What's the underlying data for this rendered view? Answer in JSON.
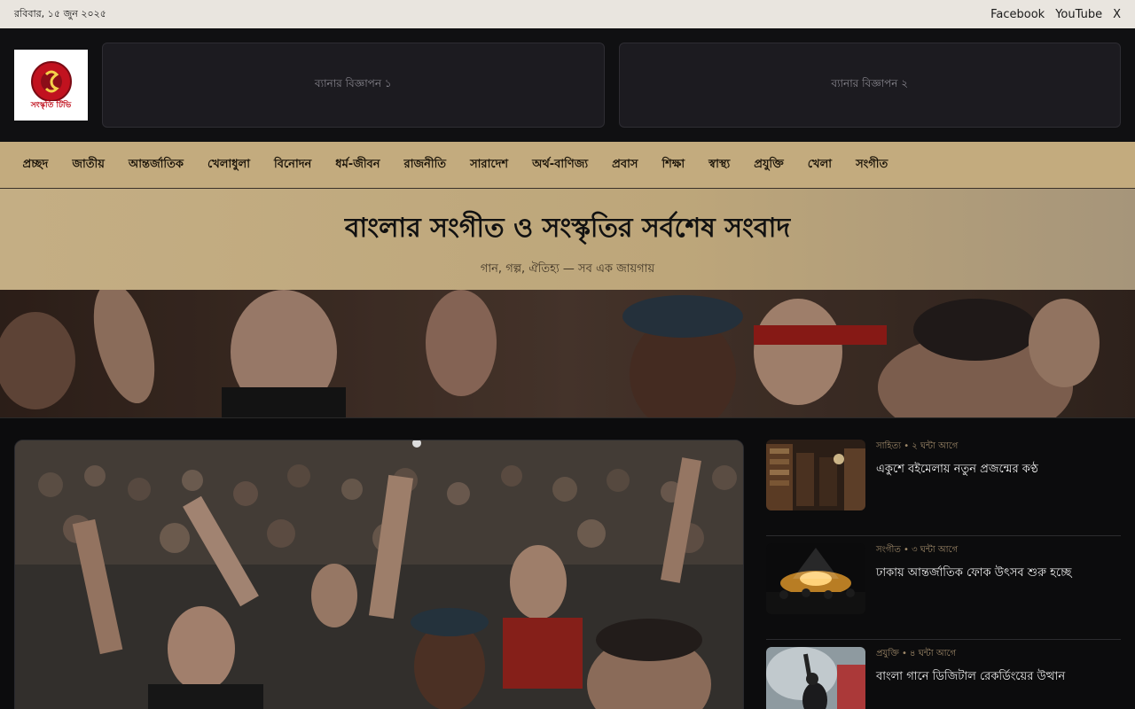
{
  "topbar": {
    "date": "রবিবার, ১৫ জুন ২০২৫",
    "social": [
      "Facebook",
      "YouTube",
      "X"
    ]
  },
  "header": {
    "logo_text": "সংস্কৃতি টিভি",
    "ads": [
      "ব্যানার বিজ্ঞাপন ১",
      "ব্যানার বিজ্ঞাপন ২"
    ]
  },
  "nav": {
    "items": [
      "প্রচ্ছদ",
      "জাতীয়",
      "আন্তর্জাতিক",
      "খেলাধুলা",
      "বিনোদন",
      "ধর্ম-জীবন",
      "রাজনীতি",
      "সারাদেশ",
      "অর্থ-বাণিজ্য",
      "প্রবাস",
      "শিক্ষা",
      "স্বাস্থ্য",
      "প্রযুক্তি",
      "খেলা",
      "সংগীত"
    ]
  },
  "banner": {
    "title": "বাংলার সংগীত ও সংস্কৃতির সর্বশেষ সংবাদ",
    "subtitle": "গান, গল্প, ঐতিহ্য — সব এক জায়গায়"
  },
  "sidebar": {
    "stories": [
      {
        "meta": "সাহিত্য • ২ ঘন্টা আগে",
        "title": "একুশে বইমেলায় নতুন প্রজন্মের কণ্ঠ"
      },
      {
        "meta": "সংগীত • ৩ ঘন্টা আগে",
        "title": "ঢাকায় আন্তর্জাতিক ফোক উৎসব শুরু হচ্ছে"
      },
      {
        "meta": "প্রযুক্তি • ৪ ঘন্টা আগে",
        "title": "বাংলা গানে ডিজিটাল রেকর্ডিংয়ের উত্থান"
      }
    ]
  },
  "colors": {
    "topbar_bg": "#e9e5df",
    "nav_bg": "#c3ab7e",
    "page_bg": "#0c0c0d"
  }
}
